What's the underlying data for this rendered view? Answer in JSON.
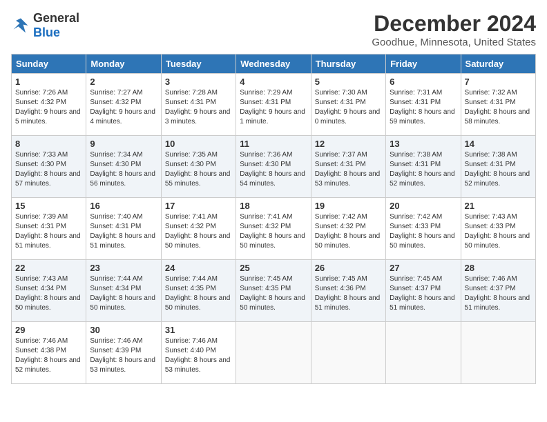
{
  "header": {
    "logo_general": "General",
    "logo_blue": "Blue",
    "month": "December 2024",
    "location": "Goodhue, Minnesota, United States"
  },
  "weekdays": [
    "Sunday",
    "Monday",
    "Tuesday",
    "Wednesday",
    "Thursday",
    "Friday",
    "Saturday"
  ],
  "weeks": [
    [
      {
        "day": "1",
        "sunrise": "Sunrise: 7:26 AM",
        "sunset": "Sunset: 4:32 PM",
        "daylight": "Daylight: 9 hours and 5 minutes."
      },
      {
        "day": "2",
        "sunrise": "Sunrise: 7:27 AM",
        "sunset": "Sunset: 4:32 PM",
        "daylight": "Daylight: 9 hours and 4 minutes."
      },
      {
        "day": "3",
        "sunrise": "Sunrise: 7:28 AM",
        "sunset": "Sunset: 4:31 PM",
        "daylight": "Daylight: 9 hours and 3 minutes."
      },
      {
        "day": "4",
        "sunrise": "Sunrise: 7:29 AM",
        "sunset": "Sunset: 4:31 PM",
        "daylight": "Daylight: 9 hours and 1 minute."
      },
      {
        "day": "5",
        "sunrise": "Sunrise: 7:30 AM",
        "sunset": "Sunset: 4:31 PM",
        "daylight": "Daylight: 9 hours and 0 minutes."
      },
      {
        "day": "6",
        "sunrise": "Sunrise: 7:31 AM",
        "sunset": "Sunset: 4:31 PM",
        "daylight": "Daylight: 8 hours and 59 minutes."
      },
      {
        "day": "7",
        "sunrise": "Sunrise: 7:32 AM",
        "sunset": "Sunset: 4:31 PM",
        "daylight": "Daylight: 8 hours and 58 minutes."
      }
    ],
    [
      {
        "day": "8",
        "sunrise": "Sunrise: 7:33 AM",
        "sunset": "Sunset: 4:30 PM",
        "daylight": "Daylight: 8 hours and 57 minutes."
      },
      {
        "day": "9",
        "sunrise": "Sunrise: 7:34 AM",
        "sunset": "Sunset: 4:30 PM",
        "daylight": "Daylight: 8 hours and 56 minutes."
      },
      {
        "day": "10",
        "sunrise": "Sunrise: 7:35 AM",
        "sunset": "Sunset: 4:30 PM",
        "daylight": "Daylight: 8 hours and 55 minutes."
      },
      {
        "day": "11",
        "sunrise": "Sunrise: 7:36 AM",
        "sunset": "Sunset: 4:30 PM",
        "daylight": "Daylight: 8 hours and 54 minutes."
      },
      {
        "day": "12",
        "sunrise": "Sunrise: 7:37 AM",
        "sunset": "Sunset: 4:31 PM",
        "daylight": "Daylight: 8 hours and 53 minutes."
      },
      {
        "day": "13",
        "sunrise": "Sunrise: 7:38 AM",
        "sunset": "Sunset: 4:31 PM",
        "daylight": "Daylight: 8 hours and 52 minutes."
      },
      {
        "day": "14",
        "sunrise": "Sunrise: 7:38 AM",
        "sunset": "Sunset: 4:31 PM",
        "daylight": "Daylight: 8 hours and 52 minutes."
      }
    ],
    [
      {
        "day": "15",
        "sunrise": "Sunrise: 7:39 AM",
        "sunset": "Sunset: 4:31 PM",
        "daylight": "Daylight: 8 hours and 51 minutes."
      },
      {
        "day": "16",
        "sunrise": "Sunrise: 7:40 AM",
        "sunset": "Sunset: 4:31 PM",
        "daylight": "Daylight: 8 hours and 51 minutes."
      },
      {
        "day": "17",
        "sunrise": "Sunrise: 7:41 AM",
        "sunset": "Sunset: 4:32 PM",
        "daylight": "Daylight: 8 hours and 50 minutes."
      },
      {
        "day": "18",
        "sunrise": "Sunrise: 7:41 AM",
        "sunset": "Sunset: 4:32 PM",
        "daylight": "Daylight: 8 hours and 50 minutes."
      },
      {
        "day": "19",
        "sunrise": "Sunrise: 7:42 AM",
        "sunset": "Sunset: 4:32 PM",
        "daylight": "Daylight: 8 hours and 50 minutes."
      },
      {
        "day": "20",
        "sunrise": "Sunrise: 7:42 AM",
        "sunset": "Sunset: 4:33 PM",
        "daylight": "Daylight: 8 hours and 50 minutes."
      },
      {
        "day": "21",
        "sunrise": "Sunrise: 7:43 AM",
        "sunset": "Sunset: 4:33 PM",
        "daylight": "Daylight: 8 hours and 50 minutes."
      }
    ],
    [
      {
        "day": "22",
        "sunrise": "Sunrise: 7:43 AM",
        "sunset": "Sunset: 4:34 PM",
        "daylight": "Daylight: 8 hours and 50 minutes."
      },
      {
        "day": "23",
        "sunrise": "Sunrise: 7:44 AM",
        "sunset": "Sunset: 4:34 PM",
        "daylight": "Daylight: 8 hours and 50 minutes."
      },
      {
        "day": "24",
        "sunrise": "Sunrise: 7:44 AM",
        "sunset": "Sunset: 4:35 PM",
        "daylight": "Daylight: 8 hours and 50 minutes."
      },
      {
        "day": "25",
        "sunrise": "Sunrise: 7:45 AM",
        "sunset": "Sunset: 4:35 PM",
        "daylight": "Daylight: 8 hours and 50 minutes."
      },
      {
        "day": "26",
        "sunrise": "Sunrise: 7:45 AM",
        "sunset": "Sunset: 4:36 PM",
        "daylight": "Daylight: 8 hours and 51 minutes."
      },
      {
        "day": "27",
        "sunrise": "Sunrise: 7:45 AM",
        "sunset": "Sunset: 4:37 PM",
        "daylight": "Daylight: 8 hours and 51 minutes."
      },
      {
        "day": "28",
        "sunrise": "Sunrise: 7:46 AM",
        "sunset": "Sunset: 4:37 PM",
        "daylight": "Daylight: 8 hours and 51 minutes."
      }
    ],
    [
      {
        "day": "29",
        "sunrise": "Sunrise: 7:46 AM",
        "sunset": "Sunset: 4:38 PM",
        "daylight": "Daylight: 8 hours and 52 minutes."
      },
      {
        "day": "30",
        "sunrise": "Sunrise: 7:46 AM",
        "sunset": "Sunset: 4:39 PM",
        "daylight": "Daylight: 8 hours and 53 minutes."
      },
      {
        "day": "31",
        "sunrise": "Sunrise: 7:46 AM",
        "sunset": "Sunset: 4:40 PM",
        "daylight": "Daylight: 8 hours and 53 minutes."
      },
      null,
      null,
      null,
      null
    ]
  ]
}
